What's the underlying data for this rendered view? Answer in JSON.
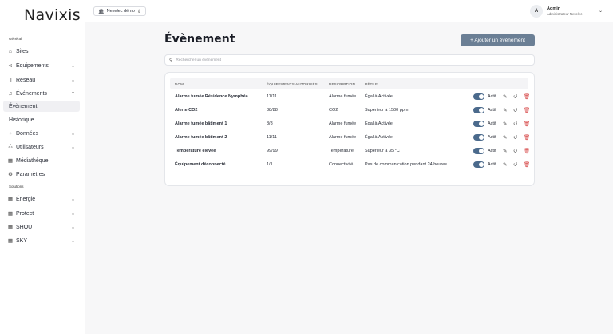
{
  "brand": {
    "logo": "Navixis"
  },
  "topbar": {
    "org_select": "Nexelec démo",
    "avatar_letter": "A",
    "user_name": "Admin",
    "user_role": "Administrateur Nexelec"
  },
  "sidebar": {
    "general_label": "Général",
    "solutions_label": "Solutions",
    "items": [
      {
        "label": "Sites",
        "icon": "home-icon"
      },
      {
        "label": "Équipements",
        "icon": "share-icon"
      },
      {
        "label": "Réseau",
        "icon": "signal-icon"
      },
      {
        "label": "Événements",
        "icon": "bell-icon"
      },
      {
        "label": "Évènement"
      },
      {
        "label": "Historique"
      },
      {
        "label": "Données",
        "icon": "chart-icon"
      },
      {
        "label": "Utilisateurs",
        "icon": "users-icon"
      },
      {
        "label": "Médiathèque",
        "icon": "grid-icon"
      },
      {
        "label": "Paramètres",
        "icon": "gear-icon"
      },
      {
        "label": "Énergie",
        "icon": "grid-icon"
      },
      {
        "label": "Protect",
        "icon": "grid-icon"
      },
      {
        "label": "SHOU",
        "icon": "grid-icon"
      },
      {
        "label": "SKY",
        "icon": "grid-icon"
      }
    ]
  },
  "main": {
    "title": "Évènement",
    "add_button": "+ Ajouter un évènement",
    "search_placeholder": "Rechercher un évènement"
  },
  "table": {
    "headers": [
      "NOM",
      "ÉQUIPEMENTS AUTORISÉS",
      "DESCRIPTION",
      "RÈGLE"
    ],
    "status_label": "Actif",
    "rows": [
      {
        "name": "Alarme fumée Résidence Nymphéa",
        "equipments": "11/11",
        "description": "Alarme fumée",
        "rule": "Égal à Activée",
        "active": true
      },
      {
        "name": "Alerte CO2",
        "equipments": "88/88",
        "description": "CO2",
        "rule": "Supérieur à 1500 ppm",
        "active": true
      },
      {
        "name": "Alarme fumée bâtiment 1",
        "equipments": "8/8",
        "description": "Alarme fumée",
        "rule": "Égal à Activée",
        "active": true
      },
      {
        "name": "Alarme fumée bâtiment 2",
        "equipments": "11/11",
        "description": "Alarme fumée",
        "rule": "Égal à Activée",
        "active": true
      },
      {
        "name": "Température élevée",
        "equipments": "99/99",
        "description": "Température",
        "rule": "Supérieur à 35 °C",
        "active": true
      },
      {
        "name": "Équipement déconnecté",
        "equipments": "1/1",
        "description": "Connectivité",
        "rule": "Pas de communication pendant 24 heures",
        "active": true
      }
    ]
  },
  "colors": {
    "accent": "#6b7f95",
    "toggle_on": "#4b6a8c",
    "danger": "#d64545"
  }
}
